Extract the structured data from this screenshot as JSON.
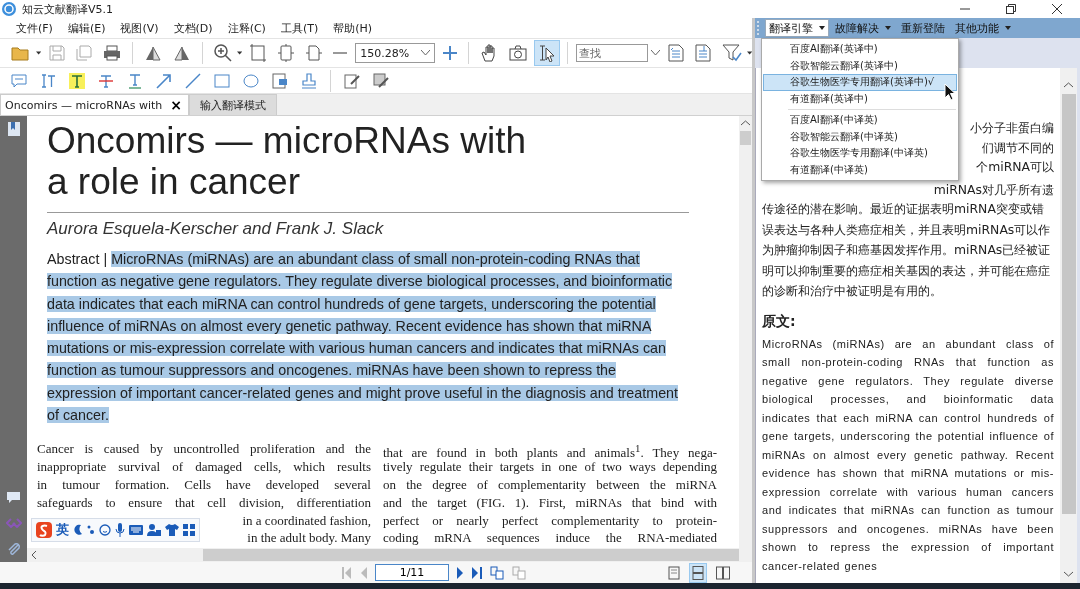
{
  "window": {
    "title": "知云文献翻译V5.1"
  },
  "menu": [
    "文件(F)",
    "编辑(E)",
    "视图(V)",
    "文档(D)",
    "注释(C)",
    "工具(T)",
    "帮助(H)"
  ],
  "toolbar": {
    "zoom": "150.28%",
    "search_placeholder": "查找",
    "view_tools": [
      {
        "kind": "hand",
        "selected": false
      },
      {
        "kind": "camera",
        "selected": false
      },
      {
        "kind": "select",
        "selected": true
      }
    ]
  },
  "tabs": [
    {
      "label": "Oncomirs — microRNAs with",
      "selected": true,
      "close": "×"
    },
    {
      "label": "输入翻译模式",
      "selected": false
    }
  ],
  "document": {
    "title_lines": [
      "Oncomirs — microRNAs with",
      "a role in cancer"
    ],
    "authors": "Aurora Esquela-Kerscher and Frank J. Slack",
    "abstract_label": "Abstract |",
    "abstract": "MicroRNAs (miRNAs) are an abundant class of small non-protein-coding RNAs that function as negative gene regulators. They regulate diverse biological processes, and bioinformatic data indicates that each miRNA can control hundreds of gene targets, underscoring the potential influence of miRNAs on almost every genetic pathway. Recent evidence has shown that miRNA mutations or mis-expression correlate with various human cancers and indicates that miRNAs can function as tumour suppressors and oncogenes. miRNAs have been shown to repress the expression of important cancer-related genes and might prove useful in the diagnosis and treatment of cancer.",
    "abstract_highlighted": true,
    "columns": [
      [
        {
          "text": "Cancer is caused by uncontrolled proliferation and the",
          "covered": false
        },
        {
          "text": "inappropriate survival of damaged cells, which results",
          "covered": false
        },
        {
          "text": "in tumour formation. Cells have developed several",
          "covered": false
        },
        {
          "text": "safeguards to ensure that cell division, differentiation",
          "covered": false
        },
        {
          "text": "in a coordinated fashion,",
          "covered": true
        },
        {
          "text": "in the adult body. Many",
          "covered": true
        }
      ],
      [
        {
          "text": "that are found in both plants and animals$^{1}$. They nega-",
          "covered": false
        },
        {
          "text": "tively regulate their targets in one of two ways depending",
          "covered": false
        },
        {
          "text": "on the degree of complementarity between the miRNA",
          "covered": false
        },
        {
          "text": "and the target (FIG. 1). First, miRNAs that bind with",
          "covered": false
        },
        {
          "text": "perfect or nearly perfect complementarity to protein-",
          "covered": false
        },
        {
          "text": "coding mRNA sequences induce the RNA-mediated",
          "covered": false
        }
      ]
    ]
  },
  "ime": {
    "mode": "英"
  },
  "nav": {
    "page": "1/11",
    "view_modes": [
      {
        "kind": "single",
        "selected": false
      },
      {
        "kind": "continuous",
        "selected": true
      },
      {
        "kind": "facing",
        "selected": false
      }
    ]
  },
  "translator": {
    "toolbar": [
      {
        "label": "翻译引擎",
        "selected": true,
        "dropdown": true
      },
      {
        "label": "故障解决",
        "selected": false,
        "dropdown": true
      },
      {
        "label": "重新登陆",
        "selected": false,
        "dropdown": false
      },
      {
        "label": "其他功能",
        "selected": false,
        "dropdown": true
      }
    ],
    "engine_groups": [
      [
        {
          "label": "百度AI翻译(英译中)",
          "selected": false
        },
        {
          "label": "谷歌智能云翻译(英译中)",
          "selected": false
        },
        {
          "label": "谷歌生物医学专用翻译(英译中)√",
          "selected": true
        },
        {
          "label": "有道翻译(英译中)",
          "selected": false
        }
      ],
      [
        {
          "label": "百度AI翻译(中译英)",
          "selected": false
        },
        {
          "label": "谷歌智能云翻译(中译英)",
          "selected": false
        },
        {
          "label": "谷歌生物医学专用翻译(中译英)",
          "selected": false
        },
        {
          "label": "有道翻译(中译英)",
          "selected": false
        }
      ]
    ],
    "translation_fragments": [
      "小分子非蛋白编",
      "们调节不同的",
      "个miRNA可以",
      "miRNAs对几乎所有遗"
    ],
    "translation": "传途径的潜在影响。最近的证据表明miRNA突变或错误表达与各种人类癌症相关，并且表明miRNAs可以作为肿瘤抑制因子和癌基因发挥作用。miRNAs已经被证明可以抑制重要的癌症相关基因的表达，并可能在癌症的诊断和治疗中被证明是有用的。",
    "original_heading": "原文:",
    "original": "MicroRNAs (miRNAs) are an abundant class of small non-protein-coding RNAs that function as negative gene regulators. They regulate diverse biological processes, and bioinformatic data indicates that each miRNA can control hundreds of gene targets, underscoring the potential influence of miRNAs on almost every genetic pathway. Recent evidence has shown that miRNA mutations or mis-expression correlate with various human cancers and indicates that miRNAs can function as tumour suppressors and oncogenes. miRNAs have been shown to repress the expression of important cancer-related genes"
  }
}
